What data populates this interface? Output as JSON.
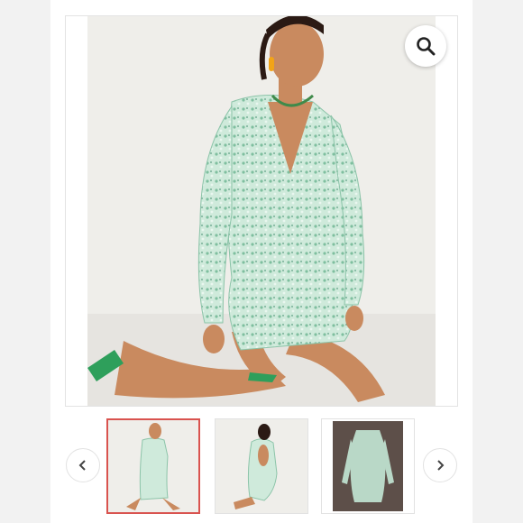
{
  "gallery": {
    "zoom_icon": "search-icon",
    "prev_icon": "chevron-left-icon",
    "next_icon": "chevron-right-icon",
    "selected_index": 0,
    "thumbnail_count": 3,
    "colors": {
      "accent_selected": "#d9534f",
      "dress_mint": "#bfe3d2",
      "background": "#f2f2f2"
    }
  }
}
